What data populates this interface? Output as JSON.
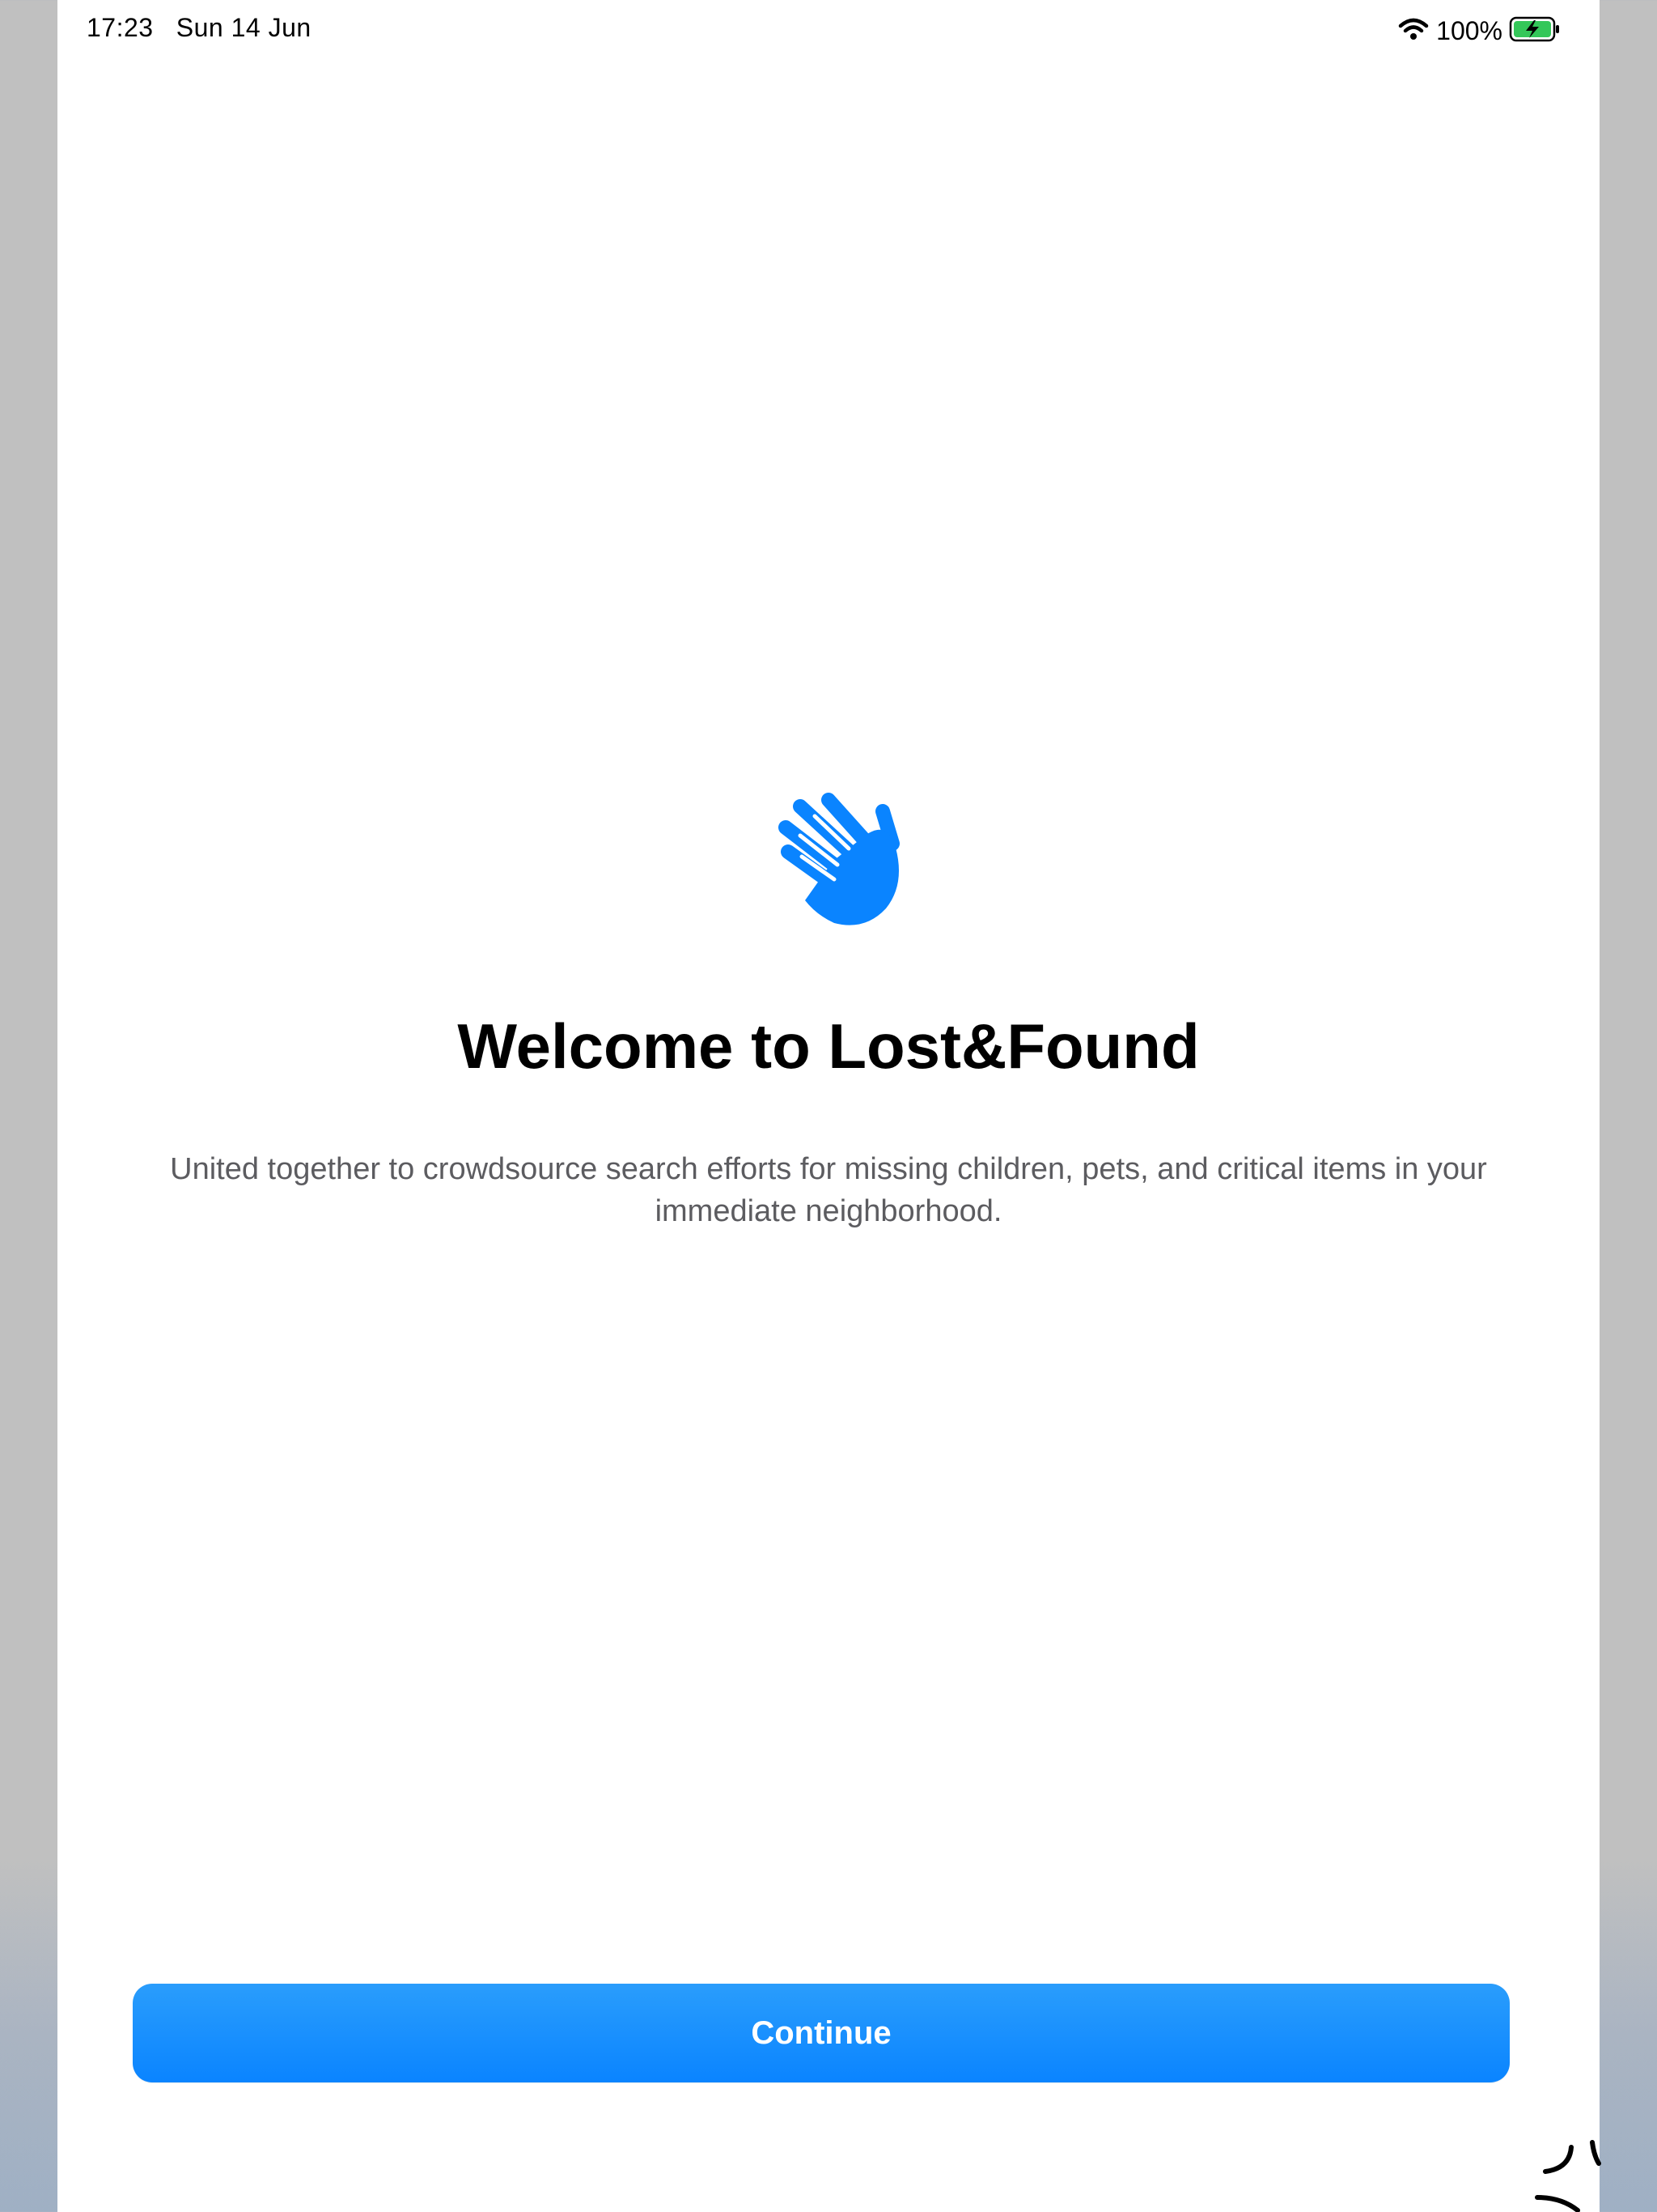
{
  "status_bar": {
    "time": "17:23",
    "date": "Sun 14 Jun",
    "battery_percent": "100%",
    "wifi_icon": "wifi-icon",
    "battery_icon": "battery-charging-icon",
    "battery_color": "#34c759"
  },
  "welcome": {
    "icon": "hand-wave-icon",
    "icon_color": "#0a84ff",
    "title": "Welcome to Lost&Found",
    "subtitle": "United together to crowdsource search efforts for missing children, pets, and critical items in your immediate neighborhood."
  },
  "actions": {
    "continue_label": "Continue",
    "accent_color": "#0a84ff"
  }
}
